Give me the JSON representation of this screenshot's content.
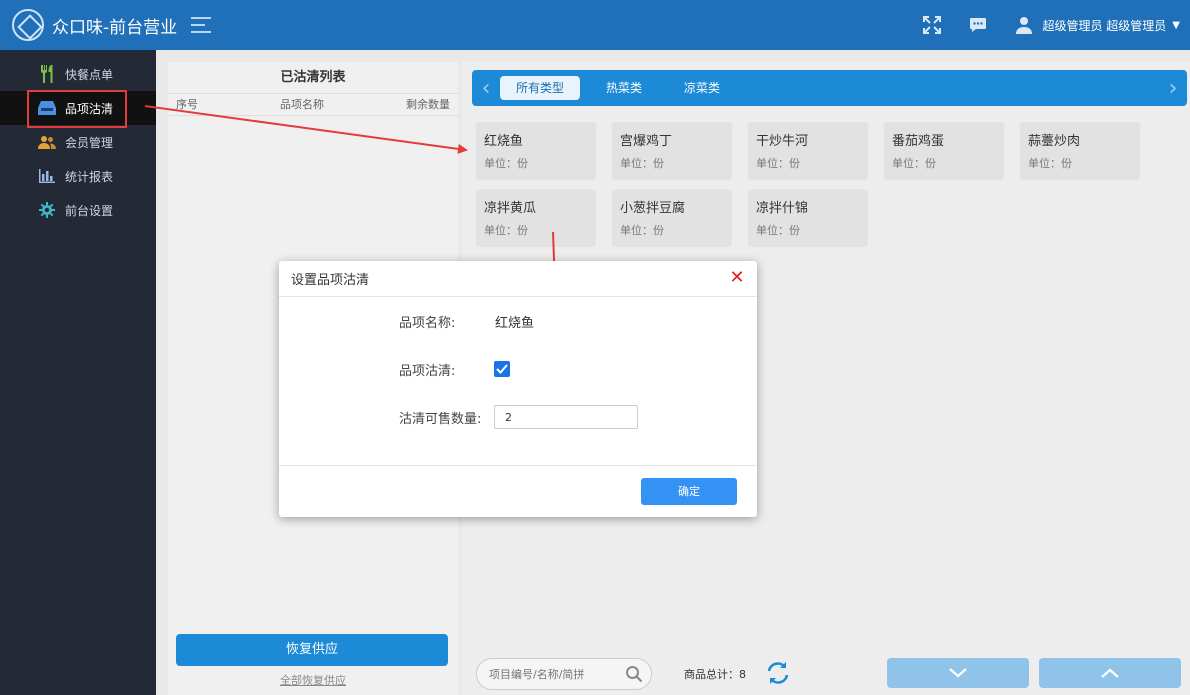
{
  "header": {
    "app_title": "众口味-前台营业",
    "user": "超级管理员 超级管理员",
    "caret": "▼"
  },
  "sidebar": {
    "items": [
      {
        "label": "快餐点单",
        "icon": "fork-knife-icon"
      },
      {
        "label": "品项沽清",
        "icon": "tray-icon"
      },
      {
        "label": "会员管理",
        "icon": "users-icon"
      },
      {
        "label": "统计报表",
        "icon": "bar-chart-icon"
      },
      {
        "label": "前台设置",
        "icon": "gear-icon"
      }
    ]
  },
  "left_panel": {
    "title": "已沽清列表",
    "columns": [
      "序号",
      "品项名称",
      "剩余数量"
    ],
    "restore_button": "恢复供应",
    "restore_all_link": "全部恢复供应"
  },
  "tabs": [
    "所有类型",
    "热菜类",
    "凉菜类"
  ],
  "products": [
    {
      "name": "红烧鱼",
      "unit": "单位：份"
    },
    {
      "name": "宫爆鸡丁",
      "unit": "单位：份"
    },
    {
      "name": "干炒牛河",
      "unit": "单位：份"
    },
    {
      "name": "番茄鸡蛋",
      "unit": "单位：份"
    },
    {
      "name": "蒜薹炒肉",
      "unit": "单位：份"
    },
    {
      "name": "凉拌黄瓜",
      "unit": "单位：份"
    },
    {
      "name": "小葱拌豆腐",
      "unit": "单位：份"
    },
    {
      "name": "凉拌什锦",
      "unit": "单位：份"
    }
  ],
  "bottom": {
    "search_placeholder": "项目编号/名称/简拼",
    "total": "商品总计：8"
  },
  "modal": {
    "title": "设置品项沽清",
    "name_label": "品项名称:",
    "name_value": "红烧鱼",
    "clear_label": "品项沽清:",
    "qty_label": "沽清可售数量:",
    "qty_value": "2",
    "confirm": "确定"
  },
  "colors": {
    "header": "#1f6fb9",
    "sidebar": "#232a36",
    "accent": "#1c8ad6",
    "annotation": "#e23c3c"
  }
}
